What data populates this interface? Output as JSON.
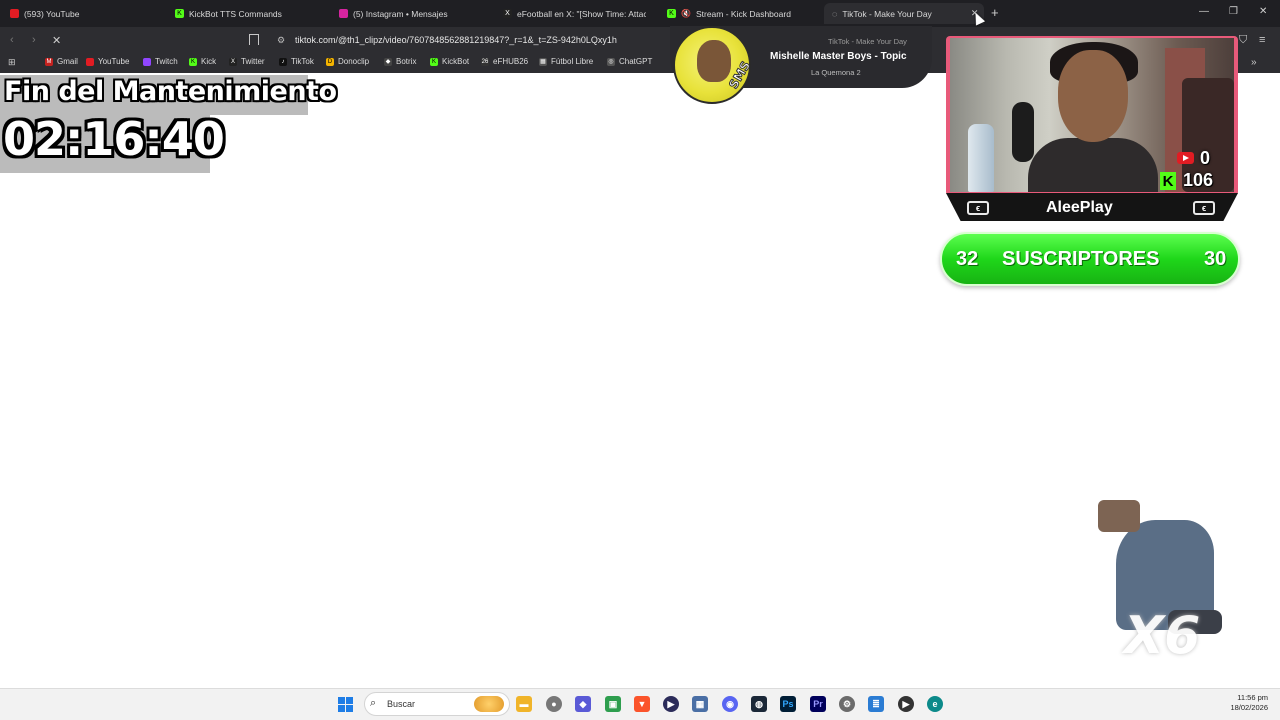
{
  "browser": {
    "tabs": [
      {
        "label": "(593) YouTube",
        "color": "#e21c23"
      },
      {
        "label": "KickBot TTS Commands",
        "color": "#53fc18"
      },
      {
        "label": "(5) Instagram • Mensajes",
        "color": "#d6249f"
      },
      {
        "label": "eFootball en X: \"[Show Time: Attack",
        "color": "#222222"
      },
      {
        "label": "Stream - Kick Dashboard",
        "color": "#53fc18"
      },
      {
        "label": "TikTok - Make Your Day",
        "color": "#333333"
      }
    ],
    "url": "tiktok.com/@th1_clipz/video/7607848562881219847?_r=1&_t=ZS-942h0LQxy1h",
    "bookmarks": [
      {
        "label": "Gmail"
      },
      {
        "label": "YouTube"
      },
      {
        "label": "Twitch"
      },
      {
        "label": "Kick"
      },
      {
        "label": "Twitter"
      },
      {
        "label": "TikTok"
      },
      {
        "label": "Donoclip"
      },
      {
        "label": "Botrix"
      },
      {
        "label": "KickBot"
      },
      {
        "label": "eFHUB26"
      },
      {
        "label": "Fútbol Libre"
      },
      {
        "label": "ChatGPT"
      }
    ]
  },
  "overlay": {
    "maintenance_title": "Fin del Mantenimiento",
    "timer": "02:16:40",
    "now_playing": {
      "title": "Mishelle Master Boys - Topic",
      "subtitle": "La Quemona 2",
      "ghost_tab_title": "TikTok - Make Your Day"
    },
    "streamer": {
      "name": "AleePlay",
      "youtube_count": "0",
      "kick_count": "106",
      "accent_color": "#53fc18"
    },
    "subscribers": {
      "left": "32",
      "label": "SUSCRIPTORES",
      "right": "30"
    },
    "gif_label": "X6"
  },
  "taskbar": {
    "search_placeholder": "Buscar",
    "time": "11:56 pm",
    "date": "18/02/2026"
  }
}
